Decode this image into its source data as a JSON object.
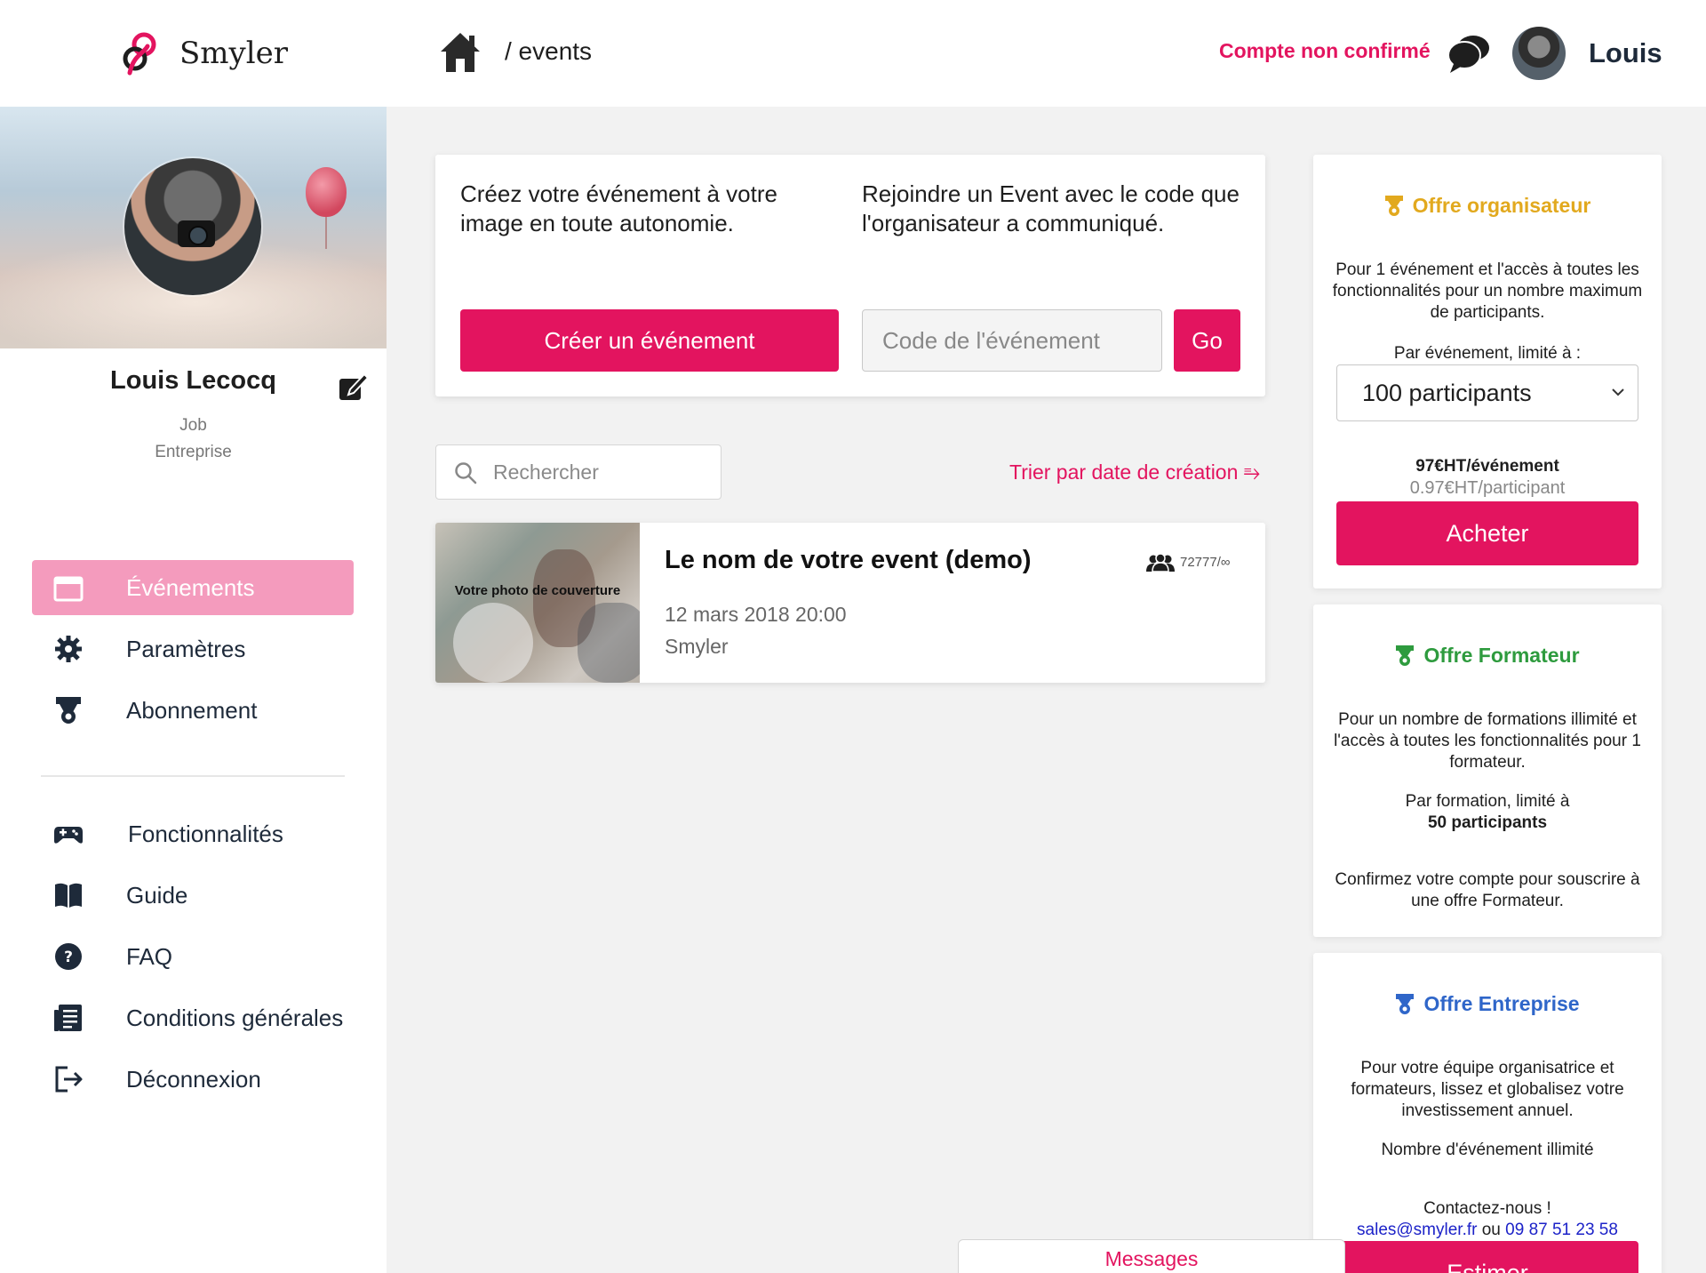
{
  "app": {
    "brand_name": "Smyler",
    "breadcrumb": "/ events",
    "account_status": "Compte non confirmé",
    "user_name": "Louis"
  },
  "colors": {
    "accent": "#e3145f",
    "active_nav_bg": "#f49bbd",
    "offer_organisateur": "#e2a91e",
    "offer_formateur": "#2e9b3e",
    "offer_entreprise": "#2f66c9"
  },
  "profile": {
    "name": "Louis Lecocq",
    "job": "Job",
    "company": "Entreprise"
  },
  "sidebar": {
    "items": [
      {
        "label": "Événements",
        "icon": "calendar-icon",
        "active": true
      },
      {
        "label": "Paramètres",
        "icon": "gear-icon"
      },
      {
        "label": "Abonnement",
        "icon": "medal-icon"
      },
      {
        "label": "Fonctionnalités",
        "icon": "gamepad-icon"
      },
      {
        "label": "Guide",
        "icon": "book-icon"
      },
      {
        "label": "FAQ",
        "icon": "question-icon"
      },
      {
        "label": "Conditions générales",
        "icon": "document-icon"
      },
      {
        "label": "Déconnexion",
        "icon": "logout-icon"
      }
    ]
  },
  "create": {
    "create_text": "Créez votre événement à votre image en toute autonomie.",
    "join_text": "Rejoindre un Event avec le code que l'organisateur a communiqué.",
    "create_button": "Créer un événement",
    "code_placeholder": "Code de l'événement",
    "go_button": "Go"
  },
  "list": {
    "search_placeholder": "Rechercher",
    "sort_label": "Trier par date de création ⥱"
  },
  "events": [
    {
      "thumb_label": "Votre photo de couverture",
      "title": "Le nom de votre event (demo)",
      "date": "12 mars 2018 20:00",
      "organizer": "Smyler",
      "participants": "72777/∞"
    }
  ],
  "offers": {
    "organisateur": {
      "title": "Offre organisateur",
      "description": "Pour 1 événement et l'accès à toutes les fonctionnalités pour un nombre maximum de participants.",
      "limit_label": "Par événement, limité à :",
      "selected_plan": "100 participants",
      "price": "97€HT/événement",
      "price_per_participant": "0.97€HT/participant",
      "buy_button": "Acheter"
    },
    "formateur": {
      "title": "Offre Formateur",
      "description": "Pour un nombre de formations illimité et l'accès à toutes les fonctionnalités pour 1 formateur.",
      "limit_label": "Par formation, limité à",
      "limit_value": "50 participants",
      "note": "Confirmez votre compte pour souscrire à une offre Formateur."
    },
    "entreprise": {
      "title": "Offre Entreprise",
      "description": "Pour votre équipe organisatrice et formateurs, lissez et globalisez votre investissement annuel.",
      "events_note": "Nombre d'événement illimité",
      "contact_label": "Contactez-nous !",
      "email": "sales@smyler.fr",
      "or": "ou",
      "phone": "09 87 51 23 58",
      "estimate_button": "Estimer"
    }
  },
  "messages": {
    "label": "Messages"
  }
}
